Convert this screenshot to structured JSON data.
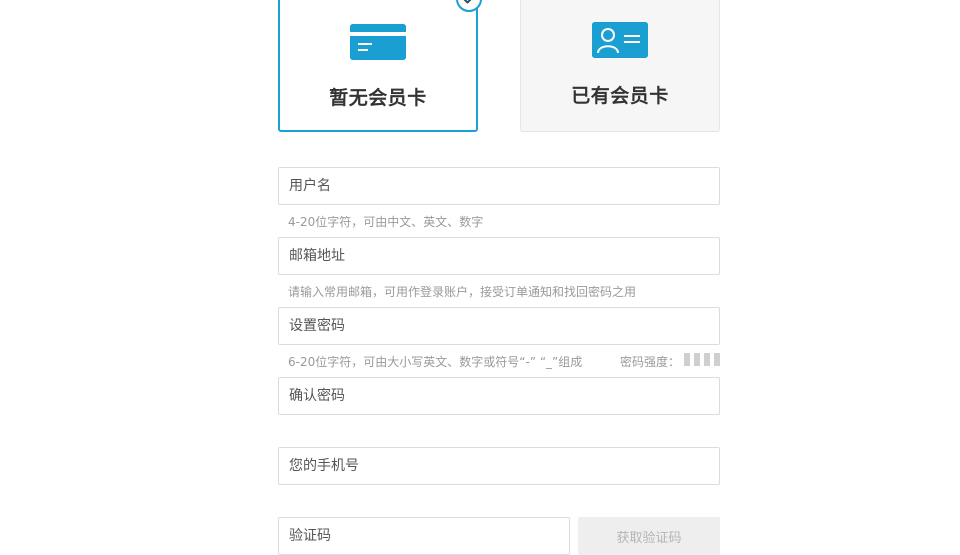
{
  "membership_options": {
    "no_card": {
      "label": "暂无会员卡",
      "icon": "credit-card-icon",
      "selected": true
    },
    "has_card": {
      "label": "已有会员卡",
      "icon": "member-id-card-icon",
      "selected": false
    },
    "selected_badge_icon": "checkmark-icon"
  },
  "form": {
    "username": {
      "placeholder": "用户名",
      "value": "",
      "hint": "4-20位字符，可由中文、英文、数字"
    },
    "email": {
      "placeholder": "邮箱地址",
      "value": "",
      "hint": "请输入常用邮箱，可用作登录账户，接受订单通知和找回密码之用"
    },
    "password": {
      "placeholder": "设置密码",
      "value": "",
      "hint": "6-20位字符，可由大小写英文、数字或符号“-” “_”组成"
    },
    "password_strength": {
      "label": "密码强度：",
      "level": 0,
      "max_level": 4
    },
    "confirm_password": {
      "placeholder": "确认密码",
      "value": ""
    },
    "phone": {
      "placeholder": "您的手机号",
      "value": ""
    },
    "verification_code": {
      "placeholder": "验证码",
      "value": ""
    },
    "get_code_button": {
      "label": "获取验证码",
      "enabled": false
    }
  },
  "colors": {
    "accent": "#1a9fd3",
    "hint_text": "#9a9a9a",
    "border": "#dcdcdc",
    "disabled_button_bg": "#eeeeee"
  }
}
